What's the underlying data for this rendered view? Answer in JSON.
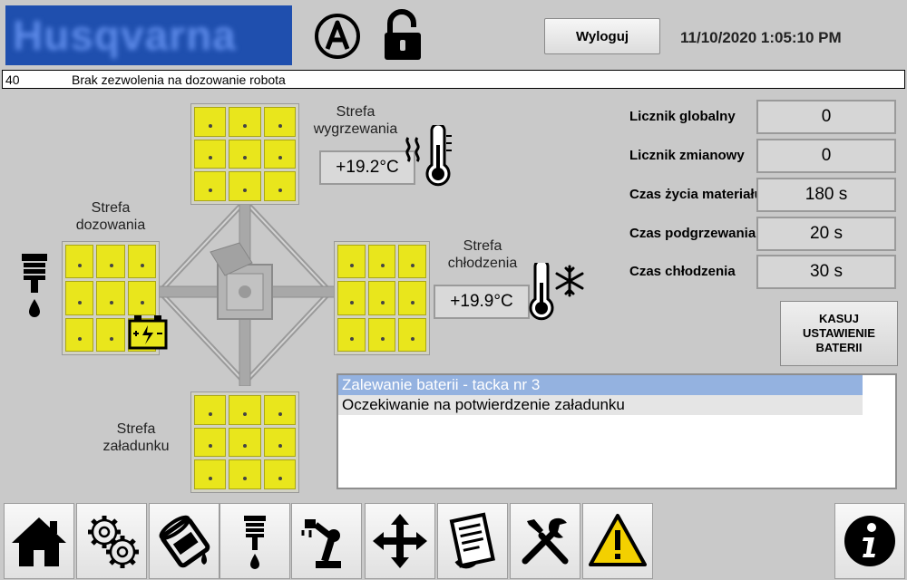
{
  "header": {
    "brand": "Husqvarna",
    "logout_label": "Wyloguj",
    "datetime": "11/10/2020 1:05:10 PM"
  },
  "alarm": {
    "code": "40",
    "message": "Brak zezwolenia na dozowanie robota"
  },
  "zones": {
    "heating": {
      "label_line1": "Strefa",
      "label_line2": "wygrzewania",
      "temperature": "+19.2°C"
    },
    "dosing": {
      "label_line1": "Strefa",
      "label_line2": "dozowania"
    },
    "cooling": {
      "label_line1": "Strefa",
      "label_line2": "chłodzenia",
      "temperature": "+19.9°C"
    },
    "loading": {
      "label_line1": "Strefa",
      "label_line2": "załadunku"
    }
  },
  "counters": [
    {
      "label": "Licznik globalny",
      "value": "0"
    },
    {
      "label": "Licznik zmianowy",
      "value": "0"
    },
    {
      "label": "Czas życia materiału",
      "value": "180 s"
    },
    {
      "label": "Czas podgrzewania",
      "value": "20 s"
    },
    {
      "label": "Czas chłodzenia",
      "value": "30 s"
    }
  ],
  "reset_button": {
    "line1": "KASUJ",
    "line2": "USTAWIENIE",
    "line3": "BATERII"
  },
  "status_messages": [
    "Zalewanie baterii - tacka nr 3",
    "Oczekiwanie na potwierdzenie załadunku"
  ],
  "nav": [
    {
      "icon": "home-icon"
    },
    {
      "icon": "gears-icon"
    },
    {
      "icon": "paint-can-icon"
    },
    {
      "icon": "dispenser-icon"
    },
    {
      "icon": "robot-arm-icon"
    },
    {
      "icon": "move-arrows-icon"
    },
    {
      "icon": "document-list-icon"
    },
    {
      "icon": "tools-icon"
    },
    {
      "icon": "warning-icon"
    },
    {
      "icon": "info-icon"
    }
  ],
  "colors": {
    "background": "#c9c9c9",
    "tray_yellow": "#e9e61c",
    "selection": "#94b2e0",
    "logo_blue": "#1f4fae"
  }
}
